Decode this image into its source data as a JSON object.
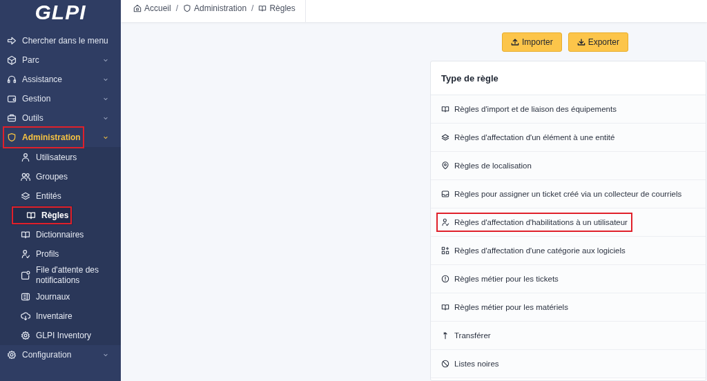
{
  "logo": "GLPI",
  "sidebar": {
    "search": "Chercher dans le menu",
    "items": [
      {
        "label": "Parc",
        "expanded": false,
        "selected": false,
        "highlighted": false
      },
      {
        "label": "Assistance",
        "expanded": false,
        "selected": false,
        "highlighted": false
      },
      {
        "label": "Gestion",
        "expanded": false,
        "selected": false,
        "highlighted": false
      },
      {
        "label": "Outils",
        "expanded": false,
        "selected": false,
        "highlighted": false
      },
      {
        "label": "Administration",
        "expanded": true,
        "selected": true,
        "highlighted": true,
        "children": [
          {
            "label": "Utilisateurs",
            "selected": false,
            "highlighted": false
          },
          {
            "label": "Groupes",
            "selected": false,
            "highlighted": false
          },
          {
            "label": "Entités",
            "selected": false,
            "highlighted": false
          },
          {
            "label": "Règles",
            "selected": true,
            "highlighted": true
          },
          {
            "label": "Dictionnaires",
            "selected": false,
            "highlighted": false
          },
          {
            "label": "Profils",
            "selected": false,
            "highlighted": false
          },
          {
            "label": "File d'attente des notifications",
            "selected": false,
            "highlighted": false
          },
          {
            "label": "Journaux",
            "selected": false,
            "highlighted": false
          },
          {
            "label": "Inventaire",
            "selected": false,
            "highlighted": false
          },
          {
            "label": "GLPI Inventory",
            "selected": false,
            "highlighted": false
          }
        ]
      },
      {
        "label": "Configuration",
        "expanded": false,
        "selected": false,
        "highlighted": false
      }
    ]
  },
  "breadcrumb": [
    {
      "label": "Accueil"
    },
    {
      "separator": "/",
      "label": "Administration"
    },
    {
      "separator": "/",
      "label": "Règles"
    }
  ],
  "actions": [
    "Importer",
    "Exporter"
  ],
  "card": {
    "title": "Type de règle",
    "rows": [
      {
        "label": "Règles d'import et de liaison des équipements",
        "highlighted": false
      },
      {
        "label": "Règles d'affectation d'un élément à une entité",
        "highlighted": false
      },
      {
        "label": "Règles de localisation",
        "highlighted": false
      },
      {
        "label": "Règles pour assigner un ticket créé via un collecteur de courriels",
        "highlighted": false
      },
      {
        "label": "Règles d'affectation d'habilitations à un utilisateur",
        "highlighted": true
      },
      {
        "label": "Règles d'affectation d'une catégorie aux logiciels",
        "highlighted": false
      },
      {
        "label": "Règles métier pour les tickets",
        "highlighted": false
      },
      {
        "label": "Règles métier pour les matériels",
        "highlighted": false
      },
      {
        "label": "Transférer",
        "highlighted": false
      },
      {
        "label": "Listes noires",
        "highlighted": false
      }
    ]
  }
}
